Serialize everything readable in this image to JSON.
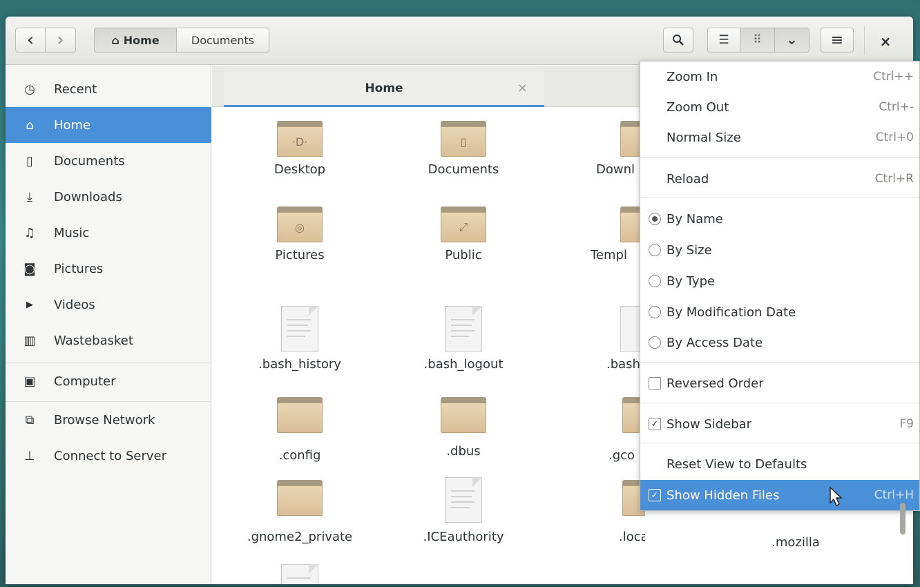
{
  "nav": {
    "back": "‹",
    "forward": "›"
  },
  "path": {
    "home": "Home",
    "documents": "Documents"
  },
  "toolbar": {
    "search": "⚲",
    "list_view": "☰",
    "grid_view": "⠿",
    "view_menu": "⌄",
    "menu": "≡",
    "close": "×"
  },
  "sidebar": {
    "items": [
      {
        "icon": "clock-icon",
        "glyph": "◷",
        "label": "Recent"
      },
      {
        "icon": "home-icon",
        "glyph": "⌂",
        "label": "Home"
      },
      {
        "icon": "document-icon",
        "glyph": "▯",
        "label": "Documents"
      },
      {
        "icon": "download-icon",
        "glyph": "⤓",
        "label": "Downloads"
      },
      {
        "icon": "music-icon",
        "glyph": "♫",
        "label": "Music"
      },
      {
        "icon": "camera-icon",
        "glyph": "◙",
        "label": "Pictures"
      },
      {
        "icon": "video-icon",
        "glyph": "▶",
        "label": "Videos"
      },
      {
        "icon": "trash-icon",
        "glyph": "▥",
        "label": "Wastebasket"
      },
      {
        "icon": "computer-icon",
        "glyph": "▣",
        "label": "Computer"
      },
      {
        "icon": "network-icon",
        "glyph": "⧉",
        "label": "Browse Network"
      },
      {
        "icon": "server-icon",
        "glyph": "⊥",
        "label": "Connect to Server"
      }
    ]
  },
  "tab": {
    "title": "Home",
    "close": "×"
  },
  "files": {
    "desktop": "Desktop",
    "documents": "Documents",
    "downloads": "Downl",
    "pictures": "Pictures",
    "public": "Public",
    "templates": "Templ",
    "bash_history": ".bash_history",
    "bash_logout": ".bash_logout",
    "bash_more": ".bash",
    "config": ".config",
    "dbus": ".dbus",
    "gconf": ".gco",
    "gnome2_private": ".gnome2_private",
    "iceauthority": ".ICEauthority",
    "local": ".local",
    "mozilla": ".mozilla"
  },
  "menu": {
    "zoom_in": "Zoom In",
    "zoom_in_acc": "Ctrl++",
    "zoom_out": "Zoom Out",
    "zoom_out_acc": "Ctrl+-",
    "normal_size": "Normal Size",
    "normal_size_acc": "Ctrl+0",
    "reload": "Reload",
    "reload_acc": "Ctrl+R",
    "by_name": "By Name",
    "by_size": "By Size",
    "by_type": "By Type",
    "by_mod_date": "By Modification Date",
    "by_access_date": "By Access Date",
    "reversed_order": "Reversed Order",
    "show_sidebar": "Show Sidebar",
    "show_sidebar_acc": "F9",
    "reset_view": "Reset View to Defaults",
    "show_hidden": "Show Hidden Files",
    "show_hidden_acc": "Ctrl+H"
  },
  "colors": {
    "accent": "#4a90d9",
    "folder": "#e0c9a4"
  }
}
